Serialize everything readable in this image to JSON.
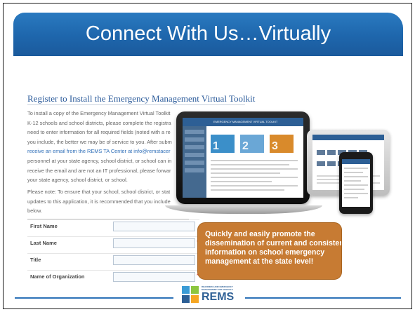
{
  "title": "Connect With Us…Virtually",
  "registration": {
    "heading": "Register to Install the Emergency Management Virtual Toolkit",
    "paragraph1": [
      "To install a copy of the Emergency Management Virtual Toolkit",
      "K-12 schools and school districts, please complete the registra",
      "need to enter information for all required fields (noted with a re",
      "you include, the better we may be of service to you. After subm",
      "receive an email from the REMS TA Center at info@remstacer",
      "personnel at your state agency, school district, or school can in",
      "receive the email and are not an IT professional, please forwar",
      "your state agency, school district, or school."
    ],
    "paragraph2": [
      "Please note: To ensure that your school, school district, or stat",
      "updates to this application, it is recommended that you include",
      "below."
    ],
    "fields": [
      {
        "label": "First Name"
      },
      {
        "label": "Last Name"
      },
      {
        "label": "Title"
      },
      {
        "label": "Name of Organization"
      }
    ]
  },
  "devices": {
    "laptop_screen_header": "EMERGENCY MANAGEMENT VIRTUAL TOOLKIT",
    "tile_numbers": [
      "1",
      "2",
      "3"
    ],
    "tile_colors": [
      "#3b8fc9",
      "#6aa7d6",
      "#d98a2b"
    ]
  },
  "callout": {
    "lines": [
      "Quickly and easily promote the",
      "dissemination of current and consistent",
      "information on school emergency",
      "management at the state level!"
    ],
    "color": "#c77b33"
  },
  "logo": {
    "small_lines": [
      "READINESS AND EMERGENCY",
      "MANAGEMENT FOR SCHOOLS",
      "TECHNICAL ASSISTANCE CENTER"
    ],
    "text": "REMS",
    "colors": [
      "#3a9bd5",
      "#8cc63f",
      "#2d5f95",
      "#f5a623"
    ]
  },
  "colors": {
    "title_bar": "#1e66ac",
    "link": "#2f6fb8",
    "rule": "#2d72b8"
  }
}
